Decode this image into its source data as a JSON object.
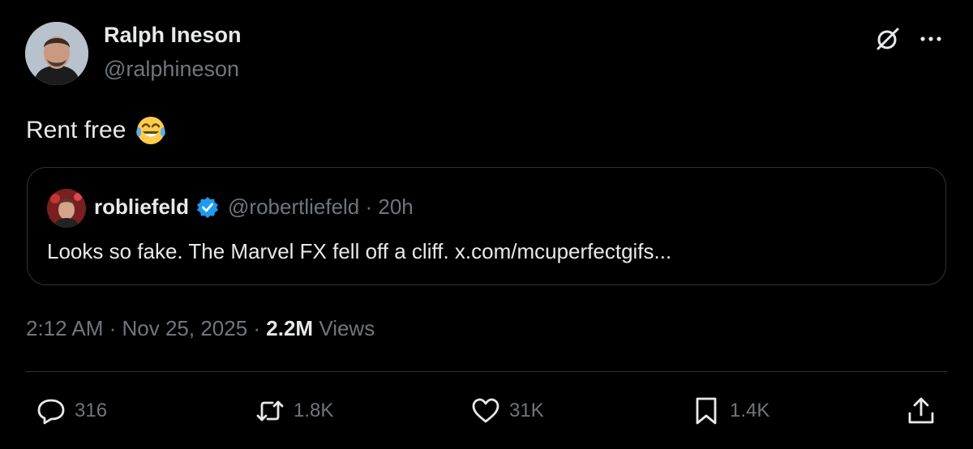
{
  "author": {
    "name": "Ralph Ineson",
    "handle": "@ralphineson",
    "avatar_icon": "profile-photo"
  },
  "header_actions": {
    "grok_icon": "grok-icon",
    "more_icon": "more-icon"
  },
  "tweet": {
    "text": "Rent free",
    "emoji": "face-with-tears-of-joy"
  },
  "quote": {
    "name": "robliefeld",
    "verified": true,
    "meta": "@robertliefeld · 20h",
    "text": "Looks so fake. The Marvel FX fell off a cliff. x.com/mcuperfectgifs..."
  },
  "meta": {
    "datetime": "2:12 AM · Nov 25, 2025 · ",
    "views_count": "2.2M",
    "views_label": " Views"
  },
  "actions": {
    "replies": "316",
    "reposts": "1.8K",
    "likes": "31K",
    "bookmarks": "1.4K"
  },
  "colors": {
    "background": "#000000",
    "text": "#e7e9ea",
    "muted": "#71767b",
    "border": "#2f3336",
    "verified": "#1d9bf0"
  }
}
